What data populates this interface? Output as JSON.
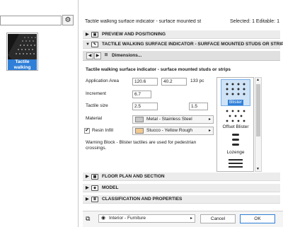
{
  "library": {
    "item_label": "Tactile walking surface indicat..."
  },
  "header": {
    "title": "Tactile walking surface indicator - surface mounted st",
    "selection_info": "Selected: 1 Editable: 1"
  },
  "sections": {
    "preview": "PREVIEW AND POSITIONING",
    "tactile": "TACTILE WALKING SURFACE INDICATOR - SURFACE MOUNTED STUDS OR STRIPS",
    "floor_plan": "FLOOR PLAN AND SECTION",
    "model": "MODEL",
    "classification": "CLASSIFICATION AND PROPERTIES"
  },
  "subnav": {
    "page_label": "Dimensions..."
  },
  "panel": {
    "heading": "Tactile walking surface indicator - surface mounted studs or strips",
    "application_area_label": "Application Area",
    "application_area_x": "120.6",
    "application_area_y": "40.2",
    "pieces": "133 pc",
    "increment_label": "Increment",
    "increment_value": "6.7",
    "tactile_size_label": "Tactile size",
    "tactile_size_a": "2.5",
    "tactile_size_b": "1.5",
    "material_label": "Material",
    "material_value": "Metal - Stainless Steel",
    "resin_label": "Resin Infill",
    "resin_checked": "✔",
    "resin_value": "Stucco - Yellow Rough",
    "warning": "Warning Block - Blister tactiles are used for pedestrian crossings.",
    "options": [
      "Blister",
      "Offset Blister",
      "Lozenge"
    ],
    "material_color": "#c8c8c8",
    "resin_color": "#f3c98e"
  },
  "footer": {
    "layer_value": "Interior - Furniture",
    "cancel": "Cancel",
    "ok": "OK"
  },
  "colors": {
    "selection_blue": "#2f7fd8"
  }
}
